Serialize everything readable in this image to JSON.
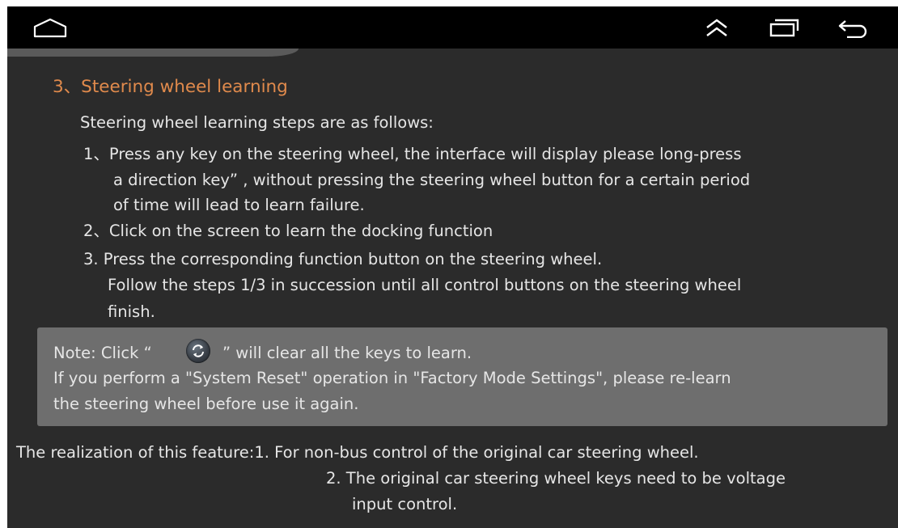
{
  "navbar": {
    "home_icon": "home-icon",
    "collapse_icon": "double-chevron-up-icon",
    "recents_icon": "recent-apps-icon",
    "back_icon": "back-arrow-icon"
  },
  "section": {
    "heading": "3、Steering wheel learning",
    "intro": "Steering wheel learning steps are as follows:",
    "step1_l1": "1、Press any key on the steering wheel, the interface will display please long-press",
    "step1_l2": "a direction key” , without pressing the steering wheel button for a certain period",
    "step1_l3": "of time will lead to learn failure.",
    "step2": "2、Click on the screen to learn the docking function",
    "step3": "3.  Press the corresponding function button on the steering wheel.",
    "follow_l1": "Follow the steps 1/3 in succession until all control buttons on the steering wheel",
    "follow_l2": "finish."
  },
  "note": {
    "prefix": "Note: Click  “",
    "suffix": "”  will clear all the keys to learn.",
    "l2": "If you perform a \"System Reset\" operation in \"Factory Mode Settings\", please re-learn",
    "l3": "the steering wheel before use it again.",
    "icon": "reset-refresh-icon"
  },
  "realization": {
    "l1": "The realization of this feature:1. For non-bus control of the original car steering wheel.",
    "l2": "2. The original car steering wheel keys need to be voltage",
    "l3": "input control."
  },
  "colors": {
    "background": "#2b2b2b",
    "heading": "#e08a4c",
    "note_box": "#6e6e6e",
    "statusbar": "#000000"
  }
}
